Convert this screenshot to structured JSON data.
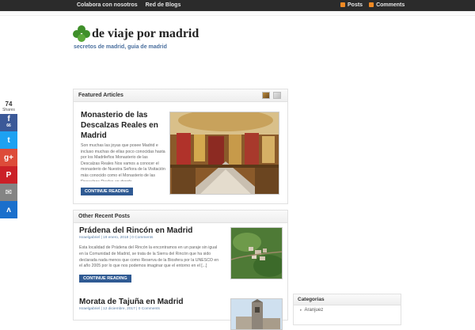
{
  "topbar": {
    "nav": [
      "Colabora con nosotros",
      "Red de Blogs"
    ],
    "feeds": [
      "Posts",
      "Comments"
    ]
  },
  "site": {
    "title": "de viaje por madrid",
    "tagline": "secretos de madrid, guia de madrid"
  },
  "social": {
    "count": "74",
    "count_label": "Shares",
    "buttons": [
      {
        "name": "facebook",
        "glyph": "f",
        "sub": "66",
        "color": "#3b5998"
      },
      {
        "name": "twitter",
        "glyph": "t",
        "sub": "",
        "color": "#1da1f2"
      },
      {
        "name": "google-plus",
        "glyph": "g+",
        "sub": "",
        "color": "#dd4b39"
      },
      {
        "name": "pinterest",
        "glyph": "P",
        "sub": "",
        "color": "#cb2027"
      },
      {
        "name": "email",
        "glyph": "✉",
        "sub": "",
        "color": "#848484"
      },
      {
        "name": "sumome",
        "glyph": "ʌ",
        "sub": "",
        "color": "#1a6fcc"
      }
    ]
  },
  "featured": {
    "heading": "Featured Articles",
    "title": "Monasterio de las Descalzas Reales en Madrid",
    "excerpt": "Son muchas las joyas que posee Madrid e incluso muchas de ellas poco conocidas hasta por los Madrileños Monasterio de las Descalzas Reales Nos vamos a conocer el monasterio de Nuestra Señora de la Visitación más conocido como el Monasterio de las Descalzas Reales en donde",
    "button": "CONTINUE READING"
  },
  "recent": {
    "heading": "Other Recent Posts",
    "posts": [
      {
        "title": "Prádena del Rincón en Madrid",
        "meta": "Israelgabriel | 19 enero, 2018 | 0 Comments",
        "excerpt": "Esta localidad de Prádena del Rincón la encontramos en un paraje sin igual en la Comunidad de Madrid, se trata de la Sierra del Rincón que ha sido declarada nada menos que como Reserva de la Biosfera por la UNESCO en el año 2005 por lo que nos podemos imaginar que el entorno en el [...]",
        "button": "CONTINUE READING"
      },
      {
        "title": "Morata de Tajuña en Madrid",
        "meta": "Israelgabriel | 12 diciembre, 2017 | 0 Comments"
      }
    ]
  },
  "sidebar": {
    "categories_heading": "Categorias",
    "categories": [
      "Aranjuez"
    ]
  }
}
